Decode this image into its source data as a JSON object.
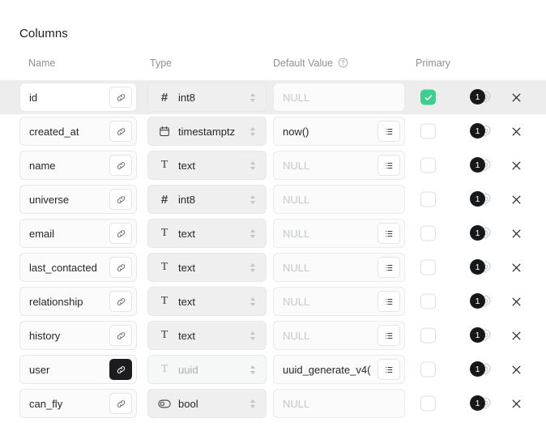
{
  "section": {
    "title": "Columns"
  },
  "headers": {
    "name": "Name",
    "type": "Type",
    "default_value": "Default Value",
    "primary": "Primary",
    "help_icon": "help-circle-icon"
  },
  "colors": {
    "accent_green": "#3ecf8e",
    "badge_dark": "#17181a",
    "active_row": "#ededed",
    "muted_text": "#8b9196"
  },
  "columns": [
    {
      "name": "id",
      "type": "int8",
      "type_icon": "hash-icon",
      "default_value": "NULL",
      "default_is_placeholder": true,
      "has_list_button": false,
      "primary": true,
      "link_active": false,
      "type_disabled": false,
      "active": true,
      "badge": "1"
    },
    {
      "name": "created_at",
      "type": "timestamptz",
      "type_icon": "calendar-icon",
      "default_value": "now()",
      "default_is_placeholder": false,
      "has_list_button": true,
      "primary": false,
      "link_active": false,
      "type_disabled": false,
      "active": false,
      "badge": "1"
    },
    {
      "name": "name",
      "type": "text",
      "type_icon": "text-icon",
      "default_value": "NULL",
      "default_is_placeholder": true,
      "has_list_button": true,
      "primary": false,
      "link_active": false,
      "type_disabled": false,
      "active": false,
      "badge": "1"
    },
    {
      "name": "universe",
      "type": "int8",
      "type_icon": "hash-icon",
      "default_value": "NULL",
      "default_is_placeholder": true,
      "has_list_button": false,
      "primary": false,
      "link_active": false,
      "type_disabled": false,
      "active": false,
      "badge": "1"
    },
    {
      "name": "email",
      "type": "text",
      "type_icon": "text-icon",
      "default_value": "NULL",
      "default_is_placeholder": true,
      "has_list_button": true,
      "primary": false,
      "link_active": false,
      "type_disabled": false,
      "active": false,
      "badge": "1"
    },
    {
      "name": "last_contacted",
      "type": "text",
      "type_icon": "text-icon",
      "default_value": "NULL",
      "default_is_placeholder": true,
      "has_list_button": true,
      "primary": false,
      "link_active": false,
      "type_disabled": false,
      "active": false,
      "badge": "1"
    },
    {
      "name": "relationship",
      "type": "text",
      "type_icon": "text-icon",
      "default_value": "NULL",
      "default_is_placeholder": true,
      "has_list_button": true,
      "primary": false,
      "link_active": false,
      "type_disabled": false,
      "active": false,
      "badge": "1"
    },
    {
      "name": "history",
      "type": "text",
      "type_icon": "text-icon",
      "default_value": "NULL",
      "default_is_placeholder": true,
      "has_list_button": true,
      "primary": false,
      "link_active": false,
      "type_disabled": false,
      "active": false,
      "badge": "1"
    },
    {
      "name": "user",
      "type": "uuid",
      "type_icon": "text-icon",
      "default_value": "uuid_generate_v4(",
      "default_is_placeholder": false,
      "has_list_button": true,
      "primary": false,
      "link_active": true,
      "type_disabled": true,
      "active": false,
      "badge": "1"
    },
    {
      "name": "can_fly",
      "type": "bool",
      "type_icon": "toggle-icon",
      "default_value": "NULL",
      "default_is_placeholder": true,
      "has_list_button": false,
      "primary": false,
      "link_active": false,
      "type_disabled": false,
      "active": false,
      "badge": "1"
    }
  ]
}
